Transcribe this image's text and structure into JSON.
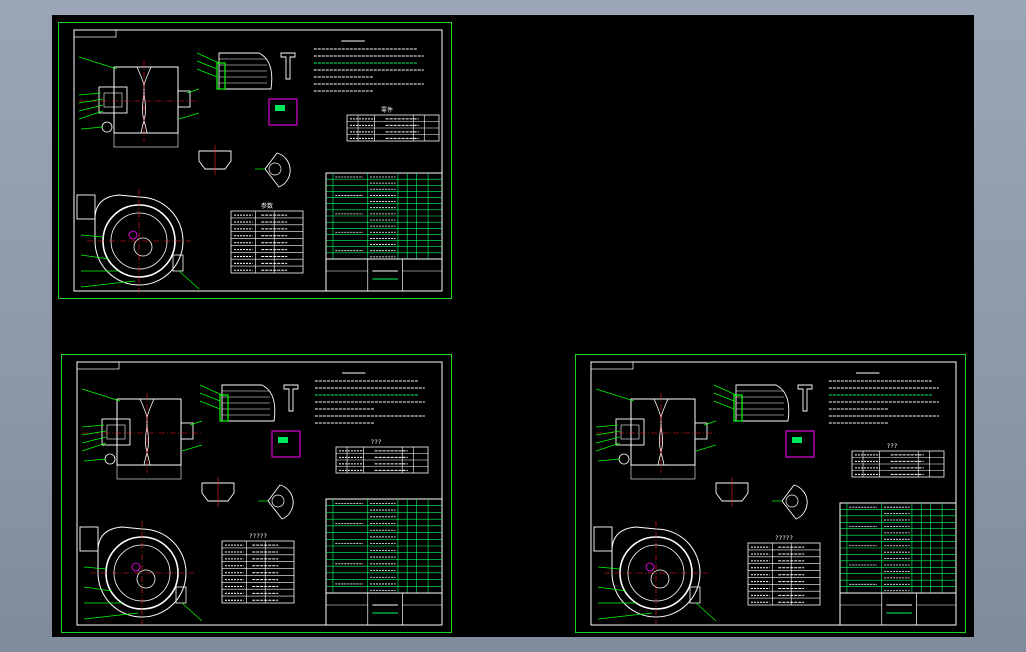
{
  "canvas": {
    "background": "#000000",
    "frame_color": "#21d321"
  },
  "colors": {
    "line": "#ffffff",
    "frame": "#21d321",
    "leader": "#00ff00",
    "accent": "#ff00ff",
    "center": "#ff2020",
    "table": "#00ff66"
  },
  "sheets": [
    {
      "id": "sheet-top-left",
      "parts_table_title": "零件",
      "spec_table_title": "参数"
    },
    {
      "id": "sheet-bottom-left",
      "parts_table_title": "???",
      "spec_table_title": "?????"
    },
    {
      "id": "sheet-bottom-right",
      "parts_table_title": "???",
      "spec_table_title": "?????"
    }
  ]
}
